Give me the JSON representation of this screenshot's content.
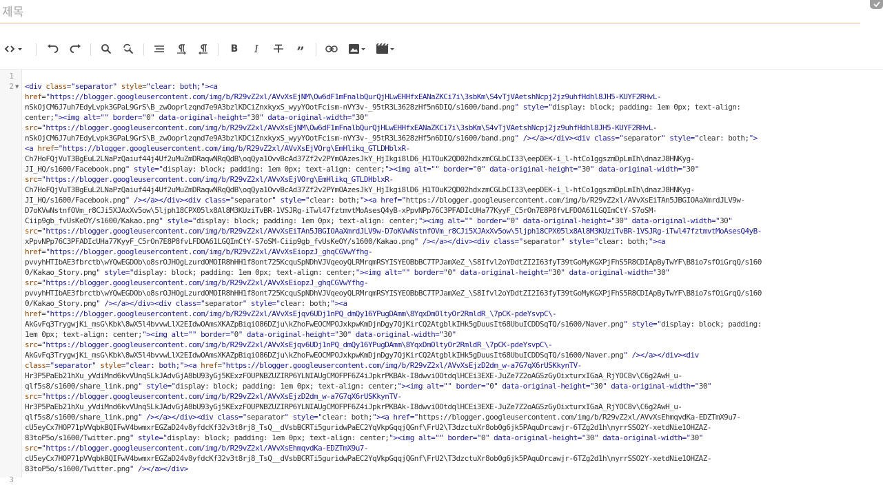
{
  "title": {
    "placeholder": "제목",
    "value": ""
  },
  "toolbar": {
    "html_toggle": "html-view-toggle",
    "buttons": [
      "undo",
      "redo",
      "find",
      "replace",
      "align",
      "paragraph-ltr",
      "paragraph-rtl",
      "bold",
      "italic",
      "strikethrough",
      "quote",
      "link",
      "image",
      "video"
    ]
  },
  "editor": {
    "line_numbers": [
      "1",
      "2",
      "3"
    ],
    "lines": [
      "<div class=\"separator\" style=\"clear: both;\"><a",
      "href=\"https://blogger.googleusercontent.com/img/b/R29vZ2xl/AVvXsEjNM\\Ow6dF1mFnalbQurQjHLwEHHfxEANaZKCi7i\\3sbKm\\S4vTjVAetshNcpj2jz9uhfHdhl8JH5-KUYF2RHvL-",
      "nSkOjCM6J7uh7EdyLvpk3GPaL9GrS\\B_zwOoprlzqnd7e9A3bzlKDCiZnxkyxS_wyyYOotFcism-nVY3v-_95tR3L3628zHf5n6DIQ/s1600/band.png\" style=\"display: block; padding: 1em 0px; text-align:",
      "center;\"><img alt=\"\" border=\"0\" data-original-height=\"30\" data-original-width=\"30\"",
      "src=\"https://blogger.googleusercontent.com/img/b/R29vZ2xl/AVvXsEjNM\\Ow6dF1mFnalbQurQjHLwEHHfxEANaZKCi7i\\3sbKm\\S4vTjVAetshNcpj2jz9uhfHdhl8JH5-KUYF2RHvL-",
      "nSkOjCM6J7uh7EdyLvpk3GPaL9GrS\\B_zwOoprlzqnd7e9A3bzlKDCiZnxkyxS_wyyYOotFcism-nVY3v-_95tR3L3628zHf5n6DIQ/s1600/band.png\" /></a></div><div class=\"separator\" style=\"clear: both;\">",
      "<a href=\"https://blogger.googleusercontent.com/img/b/R29vZ2xl/AVvXsEjVOrg\\EmHlikq_GTLDHblxR-",
      "Ch7HoFQjVuT3BgEuL2LNaPzQaiuf44j4Uf2uMuZmDRaqwNRqQdB\\oqQya1OvvBcAd37Zf2v2PYmOAzesJkY_HjIkgi8lD6_H1TOuK2QD02hdxzmCGLbCI33\\eepDEK-i_l-htCo1ggszmDpLmIh\\dnazJ8HNKyg-",
      "JI_HQ/s1600/Facebook.png\" style=\"display: block; padding: 1em 0px; text-align: center;\"><img alt=\"\" border=\"0\" data-original-height=\"30\" data-original-width=\"30\"",
      "src=\"https://blogger.googleusercontent.com/img/b/R29vZ2xl/AVvXsEjVOrg\\EmHlikq_GTLDHblxR-",
      "Ch7HoFQjVuT3BgEuL2LNaPzQaiuf44j4Uf2uMuZmDRaqwNRqQdB\\oqQya1OvvBcAd37Zf2v2PYmOAzesJkY_HjIkgi8lD6_H1TOuK2QD02hdxzmCGLbCI33\\eepDEK-i_l-htCo1ggszmDpLmIh\\dnazJ8HNKyg-",
      "JI_HQ/s1600/Facebook.png\" /></a></div><div class=\"separator\" style=\"clear: both;\"><a href=\"https://blogger.googleusercontent.com/img/b/R29vZ2xl/AVvXsEiTAn5JBGIOAaXmrdJLV9w-",
      "D7oKVwNstnfOVm_r8CJi5XJAxXv5ow\\5ljph18CPX05lx8Al8M3KUziTvBR-1VSJRg-iTwl47fztmvtMoAsesQ4yB-xPpvNPp76C3PFADIcUHa77KyyF_C5rOn7E8P8fvLFDOA61LGQImCtY-S7oSM-",
      "Ciip9gb_fvUsKeOY/s1600/Kakao.png\" style=\"display: block; padding: 1em 0px; text-align: center;\"><img alt=\"\" border=\"0\" data-original-height=\"30\" data-original-width=\"30\"",
      "src=\"https://blogger.googleusercontent.com/img/b/R29vZ2xl/AVvXsEiTAn5JBGIOAaXmrdJLV9w-D7oKVwNstnfOVm_r8CJi5XJAxXv5ow\\5ljph18CPX05lx8Al8M3KUziTvBR-1VSJRg-iTwl47fztmvtMoAsesQ4yB-",
      "xPpvNPp76C3PFADIcUHa77KyyF_C5rOn7E8P8fvLFDOA61LGQImCtY-S7oSM-Ciip9gb_fvUsKeOY/s1600/Kakao.png\" /></a></div><div class=\"separator\" style=\"clear: both;\"><a",
      "href=\"https://blogger.googleusercontent.com/img/b/R29vZ2xl/AVvXsEiopzJ_ghqCGVwYfhg-",
      "pvvyhHTIbAE3fbrctb\\wYQwEGDOb\\o8srOJHOgLzurdOMOIR8hHH1f8ont725KcquSpNDhVJVqeoyQLRMrqmRSYISYEOBbBC7TPJamXeZ_\\S8Ifvl2oYDdtZI2I63fyT39tGoMyKGXPjFhS5R8CDIApByTwYF\\B8io7sfOiGrqQ/s160",
      "0/Kakao_Story.png\" style=\"display: block; padding: 1em 0px; text-align: center;\"><img alt=\"\" border=\"0\" data-original-height=\"30\" data-original-width=\"30\"",
      "src=\"https://blogger.googleusercontent.com/img/b/R29vZ2xl/AVvXsEiopzJ_ghqCGVwYfhg-",
      "pvvyhHTIbAE3fbrctb\\wYQwEGDOb\\o8srOJHOgLzurdOMOIR8hHH1f8ont725KcquSpNDhVJVqeoyQLRMrqmRSYISYEOBbBC7TPJamXeZ_\\S8Ifvl2oYDdtZI2I63fyT39tGoMyKGXPjFhS5R8CDIApByTwYF\\B8io7sfOiGrqQ/s160",
      "0/Kakao_Story.png\" /></a></div><div class=\"separator\" style=\"clear: both;\"><a",
      "href=\"https://blogger.googleusercontent.com/img/b/R29vZ2xl/AVvXsEjqv6UDj1nPQ_dmQy16YPugDAmm\\8YqxDmOltyOr2RmldR_\\7pCK-pdeYsvpC\\-",
      "AkGvFq3TrygwjKi_msG\\Kbk\\8wX5l4bvvwLlX2EIdwOAmsXKAZpBiqiO86DZju\\kZhoFwEOCMPOJxkpwKmDjnDgy7QjKirCQ2AtgblkIHk5gDuusIt68UbuICDDSqTQ/s1600/Naver.png\" style=\"display: block; padding:",
      "1em 0px; text-align: center;\"><img alt=\"\" border=\"0\" data-original-height=\"30\" data-original-width=\"30\"",
      "src=\"https://blogger.googleusercontent.com/img/b/R29vZ2xl/AVvXsEjqv6UDj1nPQ_dmQy16YPugDAmm\\8YqxDmOltyOr2RmldR_\\7pCK-pdeYsvpC\\-",
      "AkGvFq3TrygwjKi_msG\\Kbk\\8wX5l4bvvwLlX2EIdwOAmsXKAZpBiqiO86DZju\\kZhoFwEOCMPOJxkpwKmDjnDgy7QjKirCQ2AtgblkIHk5gDuusIt68UbuICDDSqTQ/s1600/Naver.png\" /></a></div><div",
      "class=\"separator\" style=\"clear: both;\"><a href=\"https://blogger.googleusercontent.com/img/b/R29vZ2xl/AVvXsEjzD2dm_w-a7G7qX6rUSKkynTV-",
      "Hr3P5PaEb21hXu_yVdiMnd6kvVUnqSLkJAdvGjA8bU93yGj5KExzFOUPNBZUZIRP6YLNIAUgCMOFPF6Z4iJpkrPKBAk-I8dwviOOtdqlHCEi3EXE-JuZe7Z2oAGSzGyOixturxIGaA_RjYOC8v\\C6g2AwH_u-",
      "qlf5s8/s1600/share_link.png\" style=\"display: block; padding: 1em 0px; text-align: center;\"><img alt=\"\" border=\"0\" data-original-height=\"30\" data-original-width=\"30\"",
      "src=\"https://blogger.googleusercontent.com/img/b/R29vZ2xl/AVvXsEjzD2dm_w-a7G7qX6rUSKkynTV-",
      "Hr3P5PaEb21hXu_yVdiMnd6kvVUnqSLkJAdvGjA8bU93yGj5KExzFOUPNBZUZIRP6YLNIAUgCMOFPF6Z4iJpkrPKBAk-I8dwviOOtdqlHCEi3EXE-JuZe7Z2oAGSzGyOixturxIGaA_RjYOC8v\\C6g2AwH_u-",
      "qlf5s8/s1600/share_link.png\" /></a></div><div class=\"separator\" style=\"clear: both;\"><a href=\"https://blogger.googleusercontent.com/img/b/R29vZ2xl/AVvXsEhmqvdKa-EDZTmX9u7-",
      "cU5eyCx7HOP71pVVqbkBQIFwV4bwmxrEGZaD24v8yfdcKf32v3t8rj8_TsQ__dVsbBCRTi5guridwPaEC2YqVkpGqqjQGnf\\FrU2\\T3dzctuXr8ob0g6jk5PAquDrcawjr-6TZg2d1h\\nyrrSSO2Y-xetdNie1OHZAZ-",
      "83toP5o/s1600/Twitter.png\" style=\"display: block; padding: 1em 0px; text-align: center;\"><img alt=\"\" border=\"0\" data-original-height=\"30\" data-original-width=\"30\"",
      "src=\"https://blogger.googleusercontent.com/img/b/R29vZ2xl/AVvXsEhmqvdKa-EDZTmX9u7-",
      "cU5eyCx7HOP71pVVqbkBQIFwV4bwmxrEGZaD24v8yfdcKf32v3t8rj8_TsQ__dVsbBCRTi5guridwPaEC2YqVkpGqqjQGnf\\FrU2\\T3dzctuXr8ob0g6jk5PAquDrcawjr-6TZg2d1h\\nyrrSSO2Y-xetdNie1OHZAZ-",
      "83toP5o/s1600/Twitter.png\" /></a></div>"
    ]
  },
  "colors": {
    "tag": "#1a1aa6",
    "attr": "#994500",
    "text": "#333333",
    "title_border": "#e0b894"
  }
}
